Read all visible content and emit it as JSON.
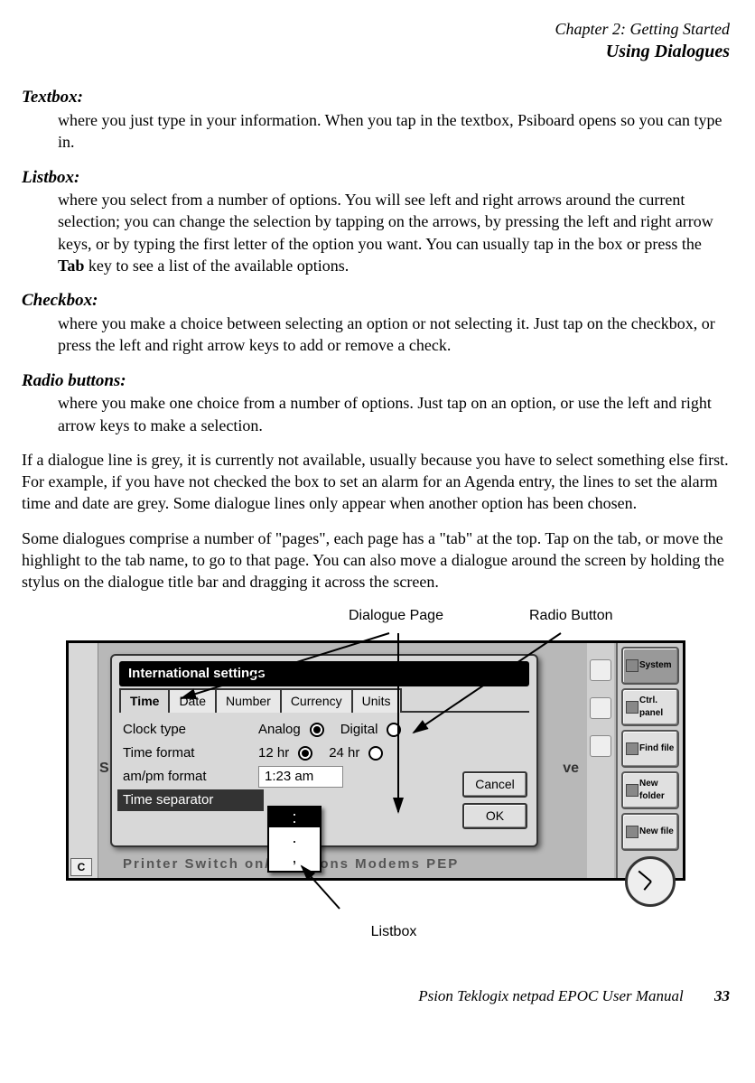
{
  "header": {
    "chapter": "Chapter 2:  Getting Started",
    "section": "Using Dialogues"
  },
  "definitions": [
    {
      "term": "Textbox:",
      "body": "where you just type in your information. When you tap in the textbox, Psiboard opens so you can type in."
    },
    {
      "term": "Listbox:",
      "body_pre": "where you select from a number of options. You will see left and right arrows around the current selection; you can change the selection by tapping on the arrows, by pressing the left and right arrow keys, or by typing the first letter of the option you want. You can usually tap in the box or press the ",
      "body_bold": "Tab",
      "body_post": " key to see a list of the available options."
    },
    {
      "term": "Checkbox:",
      "body": "where you make a choice between selecting an option or not selecting it. Just tap on the checkbox, or press the left and right arrow keys to add or remove a check."
    },
    {
      "term": "Radio buttons:",
      "body": "where you make one choice from a number of options. Just tap on an option, or use the left and right arrow keys to make a selection."
    }
  ],
  "para1": "If a dialogue line is grey, it is currently not available, usually because you have to select something else first. For example, if you have not checked the box to set an alarm for an Agenda entry, the lines to set the alarm time and date are grey. Some dialogue lines only appear when another option has been chosen.",
  "para2": "Some dialogues comprise a number of \"pages\", each page has a \"tab\" at the top. Tap on the tab, or move the highlight to the tab name, to go to that page. You can also move a dialogue around the screen by holding the stylus on the dialogue title bar and dragging it across the screen.",
  "callouts": {
    "dialogue_page": "Dialogue Page",
    "radio_button": "Radio Button",
    "listbox": "Listbox"
  },
  "dialog": {
    "title": "International settings",
    "tabs": [
      "Time",
      "Date",
      "Number",
      "Currency",
      "Units"
    ],
    "rows": {
      "clock_type": {
        "label": "Clock type",
        "opt1": "Analog",
        "opt2": "Digital"
      },
      "time_format": {
        "label": "Time format",
        "opt1": "12 hr",
        "opt2": "24 hr"
      },
      "ampm": {
        "label": "am/pm format",
        "value": "1:23 am"
      },
      "separator": {
        "label": "Time separator"
      }
    },
    "listbox_options": [
      ":",
      ".",
      ","
    ],
    "buttons": {
      "cancel": "Cancel",
      "ok": "OK"
    },
    "bg_text": "Printer    Switch on/off    ations    Modems    PEP",
    "right_items": [
      "System",
      "Ctrl. panel",
      "Find file",
      "New folder",
      "New file"
    ],
    "ove": "ve",
    "se": "S",
    "c": "C"
  },
  "footer": {
    "text": "Psion Teklogix netpad EPOC User Manual",
    "page": "33"
  }
}
